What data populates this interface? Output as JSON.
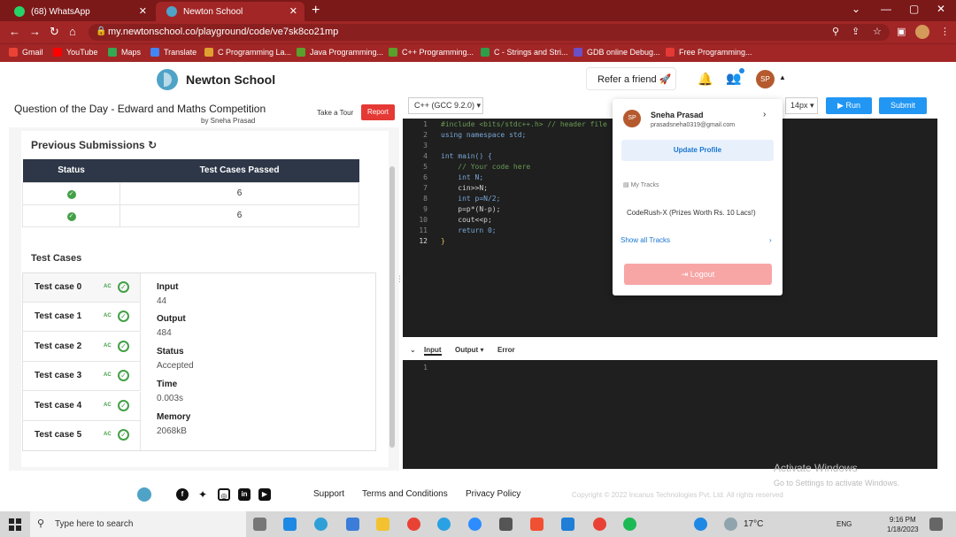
{
  "browser": {
    "tabs": [
      {
        "title": "(68) WhatsApp",
        "color": "#25d366"
      },
      {
        "title": "Newton School",
        "color": "#4fa3c7"
      }
    ],
    "url": "my.newtonschool.co/playground/code/ve7sk8co21mp",
    "bookmarks": [
      "Gmail",
      "YouTube",
      "Maps",
      "Translate",
      "C Programming La...",
      "Java Programming...",
      "C++ Programming...",
      "C - Strings and Stri...",
      "GDB online Debug...",
      "Free Programming..."
    ]
  },
  "header": {
    "brand": "Newton School",
    "refer": "Refer a friend",
    "avatar_initials": "SP"
  },
  "question": {
    "title": "Question of the Day - Edward and Maths Competition",
    "author": "by Sneha Prasad",
    "tour": "Take a Tour",
    "report": "Report"
  },
  "submissions": {
    "title": "Previous Submissions",
    "columns": [
      "Status",
      "Test Cases Passed"
    ],
    "rows": [
      {
        "passed": "6"
      },
      {
        "passed": "6"
      }
    ]
  },
  "testcases": {
    "title": "Test Cases",
    "items": [
      "Test case 0",
      "Test case 1",
      "Test case 2",
      "Test case 3",
      "Test case 4",
      "Test case 5"
    ],
    "ac_label": "AC",
    "details": {
      "input_label": "Input",
      "input": "44",
      "output_label": "Output",
      "output": "484",
      "status_label": "Status",
      "status": "Accepted",
      "time_label": "Time",
      "time": "0.003s",
      "memory_label": "Memory",
      "memory": "2068kB"
    }
  },
  "editor": {
    "language": "C++ (GCC 9.2.0)",
    "font_size": "14px",
    "run": "Run",
    "submit": "Submit",
    "lines": [
      "#include <bits/stdc++.h> // header file",
      "using namespace std;",
      "",
      "int main() {",
      "    // Your code here",
      "    int N;",
      "    cin>>N;",
      "    int p=N/2;",
      "    p=p*(N-p);",
      "    cout<<p;",
      "    return 0;",
      "}"
    ],
    "io_tabs": [
      "Input",
      "Output",
      "Error"
    ],
    "io_line": "1"
  },
  "dropdown": {
    "name": "Sneha Prasad",
    "email": "prasadsneha0319@gmail.com",
    "update_profile": "Update Profile",
    "tracks_label": "My Tracks",
    "track": "CodeRush-X (Prizes Worth Rs. 10 Lacs!)",
    "show_all": "Show all Tracks",
    "logout": "Logout"
  },
  "footer": {
    "links": [
      "Support",
      "Terms and Conditions",
      "Privacy Policy"
    ],
    "copyright": "Copyright © 2022 Incanus Technologies Pvt. Ltd. All rights reserved",
    "activate_title": "Activate Windows",
    "activate_sub": "Go to Settings to activate Windows."
  },
  "taskbar": {
    "search_placeholder": "Type here to search",
    "temperature": "17°C",
    "lang": "ENG",
    "time": "9:16 PM",
    "date": "1/18/2023"
  },
  "colors": {
    "accent": "#2196f3",
    "chrome": "#a22626",
    "success": "#43a047",
    "danger": "#e53935"
  }
}
